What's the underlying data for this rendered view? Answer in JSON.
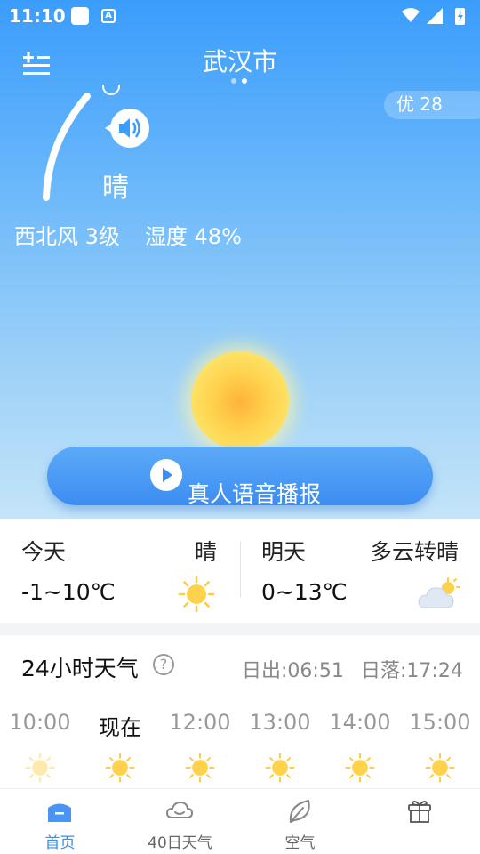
{
  "status_bar": {
    "time": "11:10",
    "a_badge": "A"
  },
  "header": {
    "city": "武汉市"
  },
  "current": {
    "condition": "晴",
    "aqi": "优 28",
    "wind": "西北风 3级",
    "humidity": "湿度 48%"
  },
  "voice_broadcast": {
    "label": "真人语音播报"
  },
  "forecast": {
    "today": {
      "day": "今天",
      "condition": "晴",
      "temp": "-1~10℃",
      "icon": "sun-icon"
    },
    "tomorrow": {
      "day": "明天",
      "condition": "多云转晴",
      "temp": "0~13℃",
      "icon": "cloud-sun-icon"
    }
  },
  "hourly": {
    "title": "24小时天气",
    "sunrise": "日出:06:51",
    "sunset": "日落:17:24",
    "items": [
      {
        "time": "10:00",
        "icon": "sun-icon"
      },
      {
        "time": "现在",
        "icon": "sun-icon"
      },
      {
        "time": "12:00",
        "icon": "sun-icon"
      },
      {
        "time": "13:00",
        "icon": "sun-icon"
      },
      {
        "time": "14:00",
        "icon": "sun-icon"
      },
      {
        "time": "15:00",
        "icon": "sun-icon"
      }
    ]
  },
  "tabbar": {
    "items": [
      {
        "label": "首页",
        "icon": "home-icon",
        "active": true
      },
      {
        "label": "40日天气",
        "icon": "cloud-icon",
        "active": false
      },
      {
        "label": "空气",
        "icon": "leaf-icon",
        "active": false
      },
      {
        "label": "",
        "icon": "gift-icon",
        "active": false
      }
    ]
  },
  "colors": {
    "accent": "#3a8cf0",
    "sun": "#ffd24d"
  }
}
